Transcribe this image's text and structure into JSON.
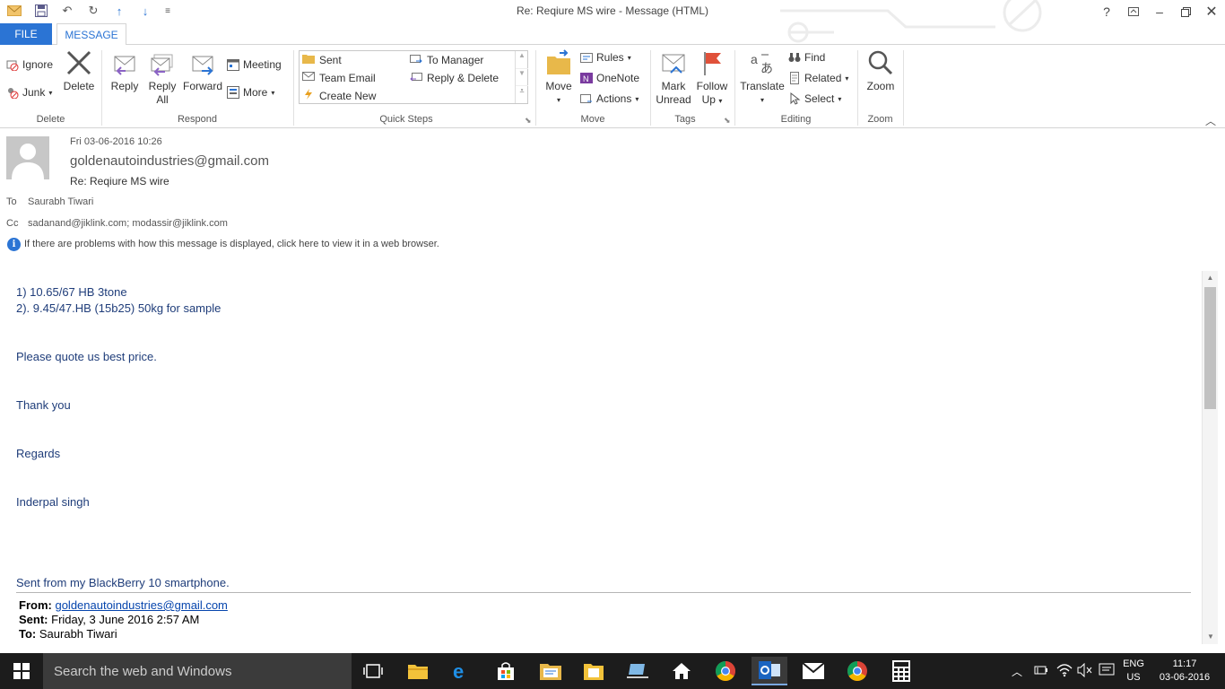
{
  "window": {
    "title": "Re: Reqiure MS wire - Message (HTML)",
    "help": "?"
  },
  "tabs": {
    "file": "FILE",
    "message": "MESSAGE"
  },
  "ribbon": {
    "delete_group": {
      "label": "Delete",
      "ignore": "Ignore",
      "junk": "Junk",
      "delete": "Delete"
    },
    "respond_group": {
      "label": "Respond",
      "reply": "Reply",
      "reply_all_line1": "Reply",
      "reply_all_line2": "All",
      "forward": "Forward",
      "meeting": "Meeting",
      "more": "More"
    },
    "quicksteps_group": {
      "label": "Quick Steps",
      "items": [
        "Sent",
        "To Manager",
        "Team Email",
        "Reply & Delete",
        "Create New"
      ]
    },
    "move_group": {
      "label": "Move",
      "move": "Move",
      "rules": "Rules",
      "onenote": "OneNote",
      "actions": "Actions"
    },
    "tags_group": {
      "label": "Tags",
      "mark_unread_line1": "Mark",
      "mark_unread_line2": "Unread",
      "follow_up_line1": "Follow",
      "follow_up_line2": "Up"
    },
    "editing_group": {
      "label": "Editing",
      "translate": "Translate",
      "find": "Find",
      "related": "Related",
      "select": "Select"
    },
    "zoom_group": {
      "label": "Zoom",
      "zoom": "Zoom"
    }
  },
  "message": {
    "date": "Fri 03-06-2016 10:26",
    "from": "goldenautoindustries@gmail.com",
    "subject": "Re: Reqiure MS wire",
    "to_label": "To",
    "to": "Saurabh Tiwari",
    "cc_label": "Cc",
    "cc": "sadanand@jiklink.com; modassir@jiklink.com",
    "info_bar": "If there are problems with how this message is displayed, click here to view it in a web browser."
  },
  "body": {
    "line1": "1) 10.65/67 HB 3tone",
    "line2": "2). 9.45/47.HB (15b25) 50kg for sample",
    "line3": "Please quote us best price.",
    "line4": "Thank you",
    "line5": "Regards",
    "line6": "Inderpal singh",
    "line7": "Sent from my BlackBerry 10 smartphone.",
    "fwd_from_label": "From:",
    "fwd_from": "goldenautoindustries@gmail.com",
    "fwd_sent_label": "Sent:",
    "fwd_sent": "Friday, 3 June 2016 2:57 AM",
    "fwd_to_label": "To:",
    "fwd_to": "Saurabh Tiwari"
  },
  "taskbar": {
    "search_placeholder": "Search the web and Windows",
    "lang_line1": "ENG",
    "lang_line2": "US",
    "time": "11:17",
    "date": "03-06-2016"
  },
  "colors": {
    "accent": "#2b74d4",
    "body_text": "#1f3d7a",
    "taskbar": "#1c1c1c"
  }
}
